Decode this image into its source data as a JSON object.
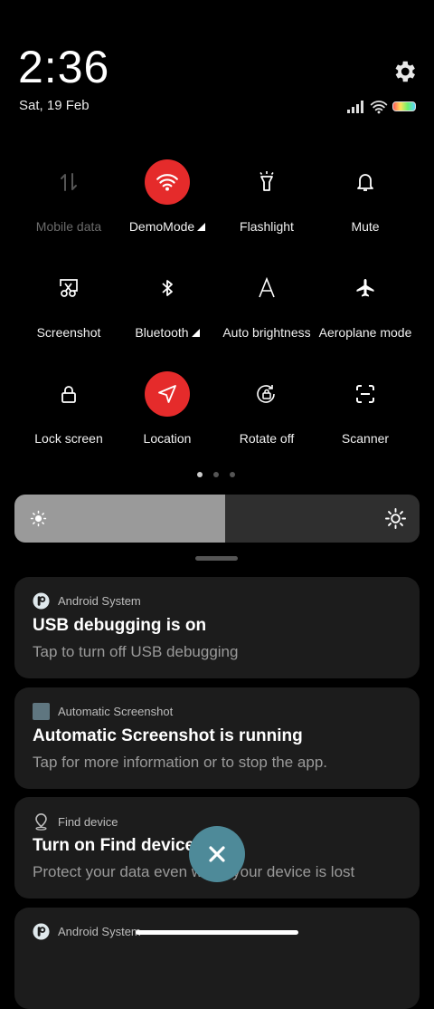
{
  "status": {
    "time": "2:36",
    "date": "Sat, 19 Feb"
  },
  "tiles": [
    {
      "label": "Mobile data",
      "icon": "mobile-data-icon",
      "active": false,
      "disabled": true,
      "arrow": false
    },
    {
      "label": "DemoMode",
      "icon": "wifi-icon",
      "active": true,
      "disabled": false,
      "arrow": true
    },
    {
      "label": "Flashlight",
      "icon": "flashlight-icon",
      "active": false,
      "disabled": false,
      "arrow": false
    },
    {
      "label": "Mute",
      "icon": "bell-icon",
      "active": false,
      "disabled": false,
      "arrow": false
    },
    {
      "label": "Screenshot",
      "icon": "screenshot-icon",
      "active": false,
      "disabled": false,
      "arrow": false
    },
    {
      "label": "Bluetooth",
      "icon": "bluetooth-icon",
      "active": false,
      "disabled": false,
      "arrow": true
    },
    {
      "label": "Auto brightness",
      "icon": "auto-brightness-icon",
      "active": false,
      "disabled": false,
      "arrow": false
    },
    {
      "label": "Aeroplane mode",
      "icon": "airplane-icon",
      "active": false,
      "disabled": false,
      "arrow": false
    },
    {
      "label": "Lock screen",
      "icon": "lock-icon",
      "active": false,
      "disabled": false,
      "arrow": false
    },
    {
      "label": "Location",
      "icon": "location-icon",
      "active": true,
      "disabled": false,
      "arrow": false
    },
    {
      "label": "Rotate off",
      "icon": "rotate-lock-icon",
      "active": false,
      "disabled": false,
      "arrow": false
    },
    {
      "label": "Scanner",
      "icon": "scanner-icon",
      "active": false,
      "disabled": false,
      "arrow": false
    }
  ],
  "pager": {
    "pages": 3,
    "current": 1
  },
  "brightness": {
    "level": 0.52
  },
  "notifications": [
    {
      "app": "Android System",
      "title": "USB debugging is on",
      "body": "Tap to turn off USB debugging"
    },
    {
      "app": "Automatic Screenshot",
      "title": "Automatic Screenshot is running",
      "body": "Tap for more information or to stop the app."
    },
    {
      "app": "Find device",
      "title": "Turn on Find device",
      "body": "Protect your data even when your device is lost"
    },
    {
      "app": "Android System",
      "title": "",
      "body": ""
    }
  ],
  "colors": {
    "accent": "#e52b2b",
    "dismiss": "#4e8a99",
    "card": "#1c1c1c"
  }
}
